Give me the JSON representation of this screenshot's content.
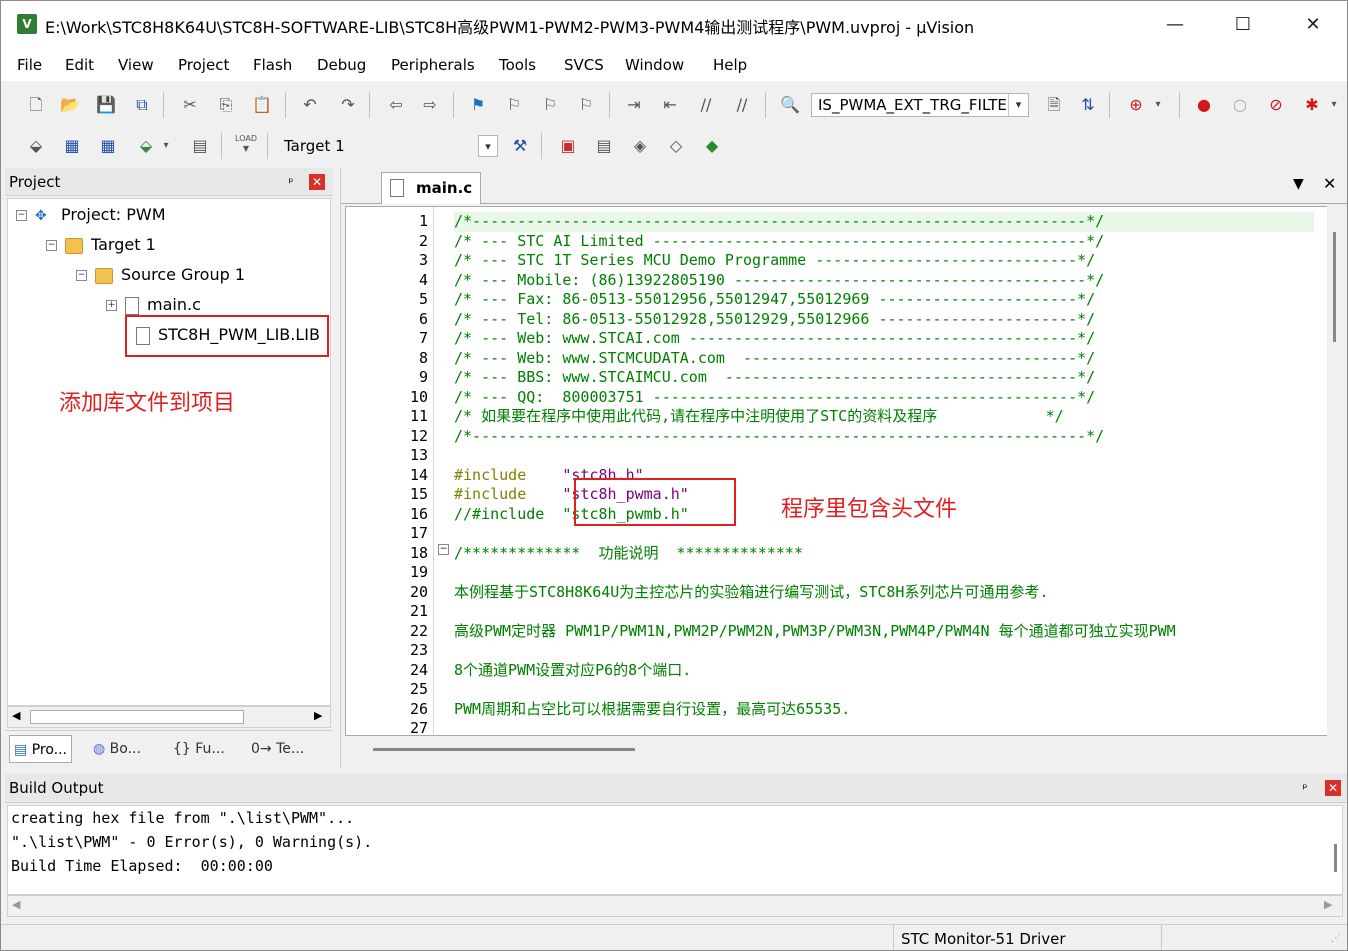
{
  "window": {
    "title": "E:\\Work\\STC8H8K64U\\STC8H-SOFTWARE-LIB\\STC8H高级PWM1-PWM2-PWM3-PWM4输出测试程序\\PWM.uvproj - µVision",
    "icon_label": "V",
    "minimize": "—",
    "maximize": "☐",
    "close": "✕"
  },
  "menu": [
    "File",
    "Edit",
    "View",
    "Project",
    "Flash",
    "Debug",
    "Peripherals",
    "Tools",
    "SVCS",
    "Window",
    "Help"
  ],
  "toolbar1": {
    "find_combo": "IS_PWMA_EXT_TRG_FILTE"
  },
  "toolbar2": {
    "target_combo": "Target 1",
    "load_label": "LOAD"
  },
  "project_panel": {
    "title": "Project",
    "pin": "ᵖ",
    "close": "✕",
    "tree": [
      {
        "label": "Project: PWM",
        "level": 0,
        "expander": "−",
        "icon": "project-icon"
      },
      {
        "label": "Target 1",
        "level": 1,
        "expander": "−",
        "icon": "target-icon"
      },
      {
        "label": "Source Group 1",
        "level": 2,
        "expander": "−",
        "icon": "folder-icon"
      },
      {
        "label": "main.c",
        "level": 3,
        "expander": "+",
        "icon": "file-icon"
      },
      {
        "label": "STC8H_PWM_LIB.LIB",
        "level": 3,
        "expander": "",
        "icon": "file-icon"
      }
    ],
    "tabs": [
      "Pro...",
      "Bo...",
      "{} Fu...",
      "0→ Te..."
    ]
  },
  "editor": {
    "tab_label": "main.c",
    "lines": [
      {
        "n": "1",
        "parts": [
          {
            "t": "/*--------------------------------------------------------------------*/",
            "c": "cm"
          }
        ]
      },
      {
        "n": "2",
        "parts": [
          {
            "t": "/* --- STC AI Limited ------------------------------------------------*/",
            "c": "cm"
          }
        ]
      },
      {
        "n": "3",
        "parts": [
          {
            "t": "/* --- STC 1T Series MCU Demo Programme -----------------------------*/",
            "c": "cm"
          }
        ]
      },
      {
        "n": "4",
        "parts": [
          {
            "t": "/* --- Mobile: (86)13922805190 ---------------------------------------*/",
            "c": "cm"
          }
        ]
      },
      {
        "n": "5",
        "parts": [
          {
            "t": "/* --- Fax: 86-0513-55012956,55012947,55012969 ----------------------*/",
            "c": "cm"
          }
        ]
      },
      {
        "n": "6",
        "parts": [
          {
            "t": "/* --- Tel: 86-0513-55012928,55012929,55012966 ----------------------*/",
            "c": "cm"
          }
        ]
      },
      {
        "n": "7",
        "parts": [
          {
            "t": "/* --- Web: www.STCAI.com -------------------------------------------*/",
            "c": "cm"
          }
        ]
      },
      {
        "n": "8",
        "parts": [
          {
            "t": "/* --- Web: www.STCMCUDATA.com  -------------------------------------*/",
            "c": "cm"
          }
        ]
      },
      {
        "n": "9",
        "parts": [
          {
            "t": "/* --- BBS: www.STCAIMCU.com  ---------------------------------------*/",
            "c": "cm"
          }
        ]
      },
      {
        "n": "10",
        "parts": [
          {
            "t": "/* --- QQ:  800003751 -----------------------------------------------*/",
            "c": "cm"
          }
        ]
      },
      {
        "n": "11",
        "parts": [
          {
            "t": "/* 如果要在程序中使用此代码,请在程序中注明使用了STC的资料及程序            */",
            "c": "cm"
          }
        ]
      },
      {
        "n": "12",
        "parts": [
          {
            "t": "/*--------------------------------------------------------------------*/",
            "c": "cm"
          }
        ]
      },
      {
        "n": "13",
        "parts": [
          {
            "t": "",
            "c": "cm"
          }
        ]
      },
      {
        "n": "14",
        "parts": [
          {
            "t": "#include    ",
            "c": "kw"
          },
          {
            "t": "\"stc8h.h\"",
            "c": "str"
          }
        ]
      },
      {
        "n": "15",
        "parts": [
          {
            "t": "#include    ",
            "c": "kw"
          },
          {
            "t": "\"stc8h_pwma.h\"",
            "c": "str"
          }
        ]
      },
      {
        "n": "16",
        "parts": [
          {
            "t": "//#include  ",
            "c": "cm"
          },
          {
            "t": "\"stc8h_pwmb.h\"",
            "c": "cm"
          }
        ]
      },
      {
        "n": "17",
        "parts": [
          {
            "t": "",
            "c": "cm"
          }
        ]
      },
      {
        "n": "18",
        "parts": [
          {
            "t": "/*************  功能说明  **************",
            "c": "cm"
          }
        ]
      },
      {
        "n": "19",
        "parts": [
          {
            "t": "",
            "c": "cm"
          }
        ]
      },
      {
        "n": "20",
        "parts": [
          {
            "t": "本例程基于STC8H8K64U为主控芯片的实验箱进行编写测试，STC8H系列芯片可通用参考.",
            "c": "cm"
          }
        ]
      },
      {
        "n": "21",
        "parts": [
          {
            "t": "",
            "c": "cm"
          }
        ]
      },
      {
        "n": "22",
        "parts": [
          {
            "t": "高级PWM定时器 PWM1P/PWM1N,PWM2P/PWM2N,PWM3P/PWM3N,PWM4P/PWM4N 每个通道都可独立实现PWM",
            "c": "cm"
          }
        ]
      },
      {
        "n": "23",
        "parts": [
          {
            "t": "",
            "c": "cm"
          }
        ]
      },
      {
        "n": "24",
        "parts": [
          {
            "t": "8个通道PWM设置对应P6的8个端口.",
            "c": "cm"
          }
        ]
      },
      {
        "n": "25",
        "parts": [
          {
            "t": "",
            "c": "cm"
          }
        ]
      },
      {
        "n": "26",
        "parts": [
          {
            "t": "PWM周期和占空比可以根据需要自行设置，最高可达65535.",
            "c": "cm"
          }
        ]
      },
      {
        "n": "27",
        "parts": [
          {
            "t": "",
            "c": "cm"
          }
        ]
      }
    ]
  },
  "build_output": {
    "title": "Build Output",
    "lines": [
      "creating hex file from \".\\list\\PWM\"...",
      "\".\\list\\PWM\" - 0 Error(s), 0 Warning(s).",
      "Build Time Elapsed:  00:00:00"
    ]
  },
  "status": {
    "driver": "STC Monitor-51 Driver"
  },
  "annotations": {
    "add_lib": "添加库文件到项目",
    "include_headers": "程序里包含头文件"
  },
  "colors": {
    "comment": "#008000",
    "keyword": "#808000",
    "string": "#800080",
    "annotation": "#e02020"
  }
}
